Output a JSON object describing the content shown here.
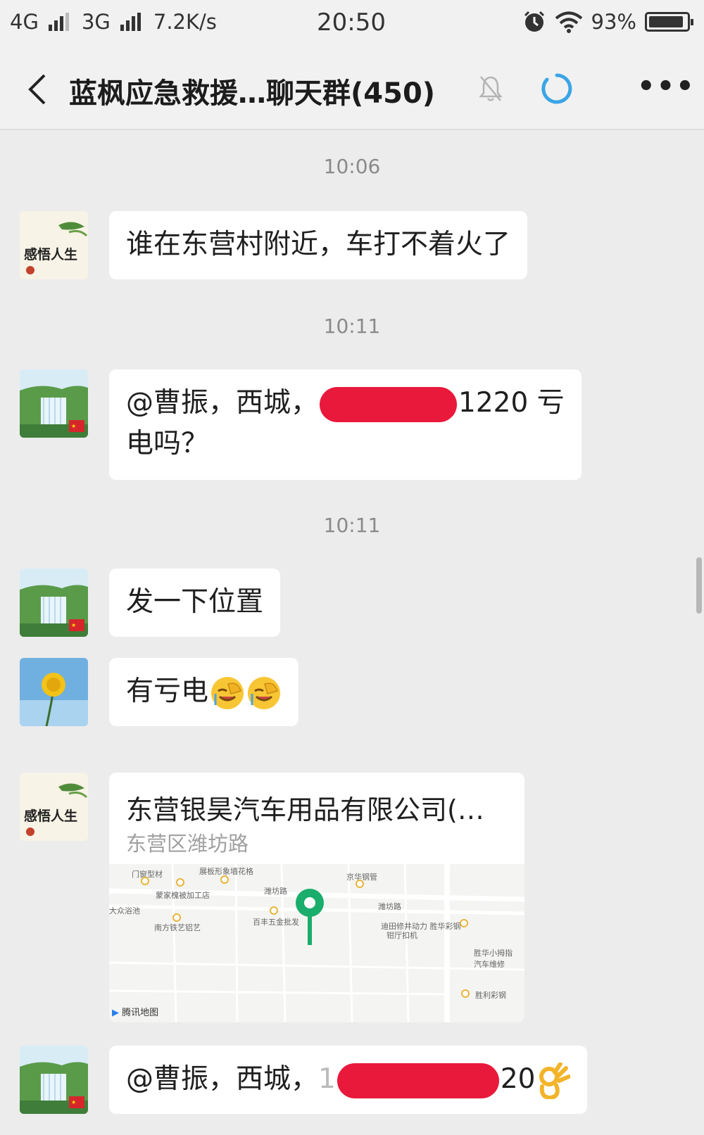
{
  "status_bar": {
    "network1": "4G",
    "network2": "3G",
    "speed": "7.2K/s",
    "time": "20:50",
    "battery": "93%",
    "battery_level": 0.93
  },
  "nav": {
    "title": "蓝枫应急救援…聊天群(450)",
    "icons": [
      "back-arrow-icon",
      "bell-muted-icon",
      "sync-icon",
      "more-icon"
    ]
  },
  "messages": [
    {
      "time": "10:06",
      "text": "谁在东营村附近，车打不着火了"
    },
    {
      "time": "10:11",
      "line1_prefix": "@曹振，西城，",
      "line1_suffix": "1220 亏",
      "line2": "电吗？"
    },
    {
      "time": "10:11",
      "text": "发一下位置"
    },
    {
      "text": "有亏电"
    },
    {
      "location_title": "东营银昊汽车用品有限公司(…",
      "location_address": "东营区潍坊路",
      "map_labels": [
        "门窗型材",
        "展板形象墙花格",
        "京华钢管",
        "潍坊路",
        "蒙家槐被加工店",
        "大众浴池",
        "百丰五金批发",
        "潍坊路",
        "南方铁艺铝艺",
        "迪田修井动力 胜华彩钢",
        "钳厅扣机",
        "胜华小拇指 汽车维修",
        "胜利彩钢",
        "腾讯地图"
      ]
    },
    {
      "prefix": "@曹振，西城，",
      "digit_before": "1",
      "suffix": "20"
    }
  ],
  "colors": {
    "accent": "#3aa5e6",
    "redaction": "#e8193b",
    "map_pin": "#1aad6b"
  }
}
